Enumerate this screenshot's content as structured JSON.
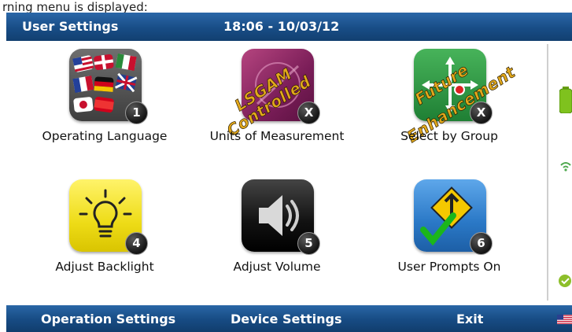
{
  "caption": "rning menu is displayed:",
  "titlebar": {
    "title": "User Settings",
    "datetime": "18:06 - 10/03/12"
  },
  "tiles": [
    {
      "label": "Operating Language",
      "badge": "1",
      "overlay": []
    },
    {
      "label": "Units of Measurement",
      "badge": "X",
      "overlay": [
        "LSGAM",
        "Controlled"
      ]
    },
    {
      "label": "Select by Group",
      "badge": "X",
      "overlay": [
        "Future",
        "Enhancement"
      ]
    },
    {
      "label": "Adjust Backlight",
      "badge": "4",
      "overlay": []
    },
    {
      "label": "Adjust Volume",
      "badge": "5",
      "overlay": []
    },
    {
      "label": "User Prompts On",
      "badge": "6",
      "overlay": []
    }
  ],
  "footer": {
    "operation_settings": "Operation Settings",
    "device_settings": "Device Settings",
    "exit": "Exit"
  },
  "icons": {
    "status": [
      "battery-icon",
      "signal-icon",
      "check-icon"
    ],
    "tiles": [
      "language-flags-icon",
      "units-icon",
      "select-group-icon",
      "backlight-bulb-icon",
      "volume-speaker-icon",
      "user-prompts-sign-icon"
    ],
    "footer_flag": "us-flag-icon"
  },
  "colors": {
    "titlebar": "#184d86",
    "footer": "#174b83",
    "overlay_text": "#e2a81b",
    "badge": "#1a1a1a",
    "battery": "#7fc21e",
    "check": "#8dbf2a",
    "backlight_bg": "#f2e12a",
    "units_bg": "#8e2c6a",
    "group_bg": "#2c9a3f",
    "prompts_bg": "#2f7fd0"
  }
}
